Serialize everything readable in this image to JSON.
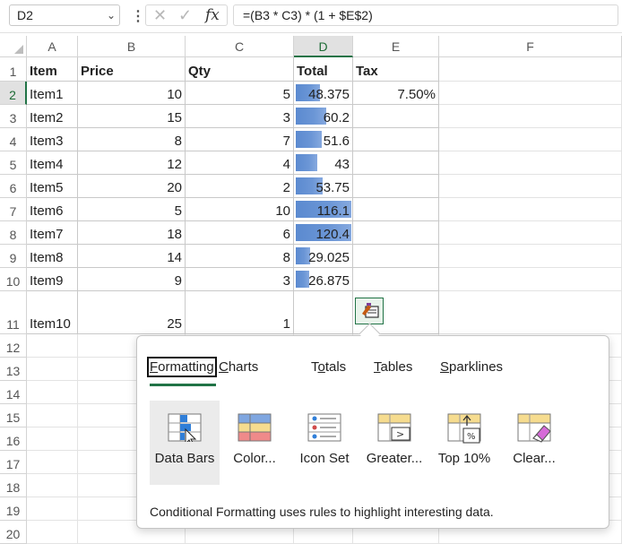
{
  "formula_bar": {
    "name_box": "D2",
    "fx_label": "fx",
    "formula": "=(B3 * C3) * (1 + $E$2)"
  },
  "columns": [
    "A",
    "B",
    "C",
    "D",
    "E",
    "F"
  ],
  "rows": [
    "1",
    "2",
    "3",
    "4",
    "5",
    "6",
    "7",
    "8",
    "9",
    "10",
    "11",
    "12",
    "13",
    "14",
    "15",
    "16",
    "17",
    "18",
    "19",
    "20"
  ],
  "headers": [
    "Item",
    "Price",
    "Qty",
    "Total",
    "Tax"
  ],
  "table": [
    {
      "item": "Item1",
      "price": "10",
      "qty": "5",
      "total": "48.375",
      "tax": "7.50%",
      "bar": 0.44
    },
    {
      "item": "Item2",
      "price": "15",
      "qty": "3",
      "total": "60.2",
      "bar": 0.55
    },
    {
      "item": "Item3",
      "price": "8",
      "qty": "7",
      "total": "51.6",
      "bar": 0.47
    },
    {
      "item": "Item4",
      "price": "12",
      "qty": "4",
      "total": "43",
      "bar": 0.39
    },
    {
      "item": "Item5",
      "price": "20",
      "qty": "2",
      "total": "53.75",
      "bar": 0.49
    },
    {
      "item": "Item6",
      "price": "5",
      "qty": "10",
      "total": "116.1",
      "bar": 1.0
    },
    {
      "item": "Item7",
      "price": "18",
      "qty": "6",
      "total": "120.4",
      "bar": 1.0
    },
    {
      "item": "Item8",
      "price": "14",
      "qty": "8",
      "total": "29.025",
      "bar": 0.26
    },
    {
      "item": "Item9",
      "price": "9",
      "qty": "3",
      "total": "26.875",
      "bar": 0.24
    },
    {
      "item": "Item10",
      "price": "25",
      "qty": "1",
      "total": "",
      "bar": 0
    }
  ],
  "quick_analysis": {
    "tabs": [
      "Formatting",
      "Charts",
      "Totals",
      "Tables",
      "Sparklines"
    ],
    "tab_access_keys": [
      "F",
      "C",
      "o",
      "T",
      "S"
    ],
    "active_tab": "Formatting",
    "options": [
      "Data Bars",
      "Color...",
      "Icon Set",
      "Greater...",
      "Top 10%",
      "Clear..."
    ],
    "top10_badge": "%",
    "description": "Conditional Formatting uses rules to highlight interesting data."
  },
  "colors": {
    "accent": "#217346",
    "data_bar": "#5b8ad0"
  }
}
